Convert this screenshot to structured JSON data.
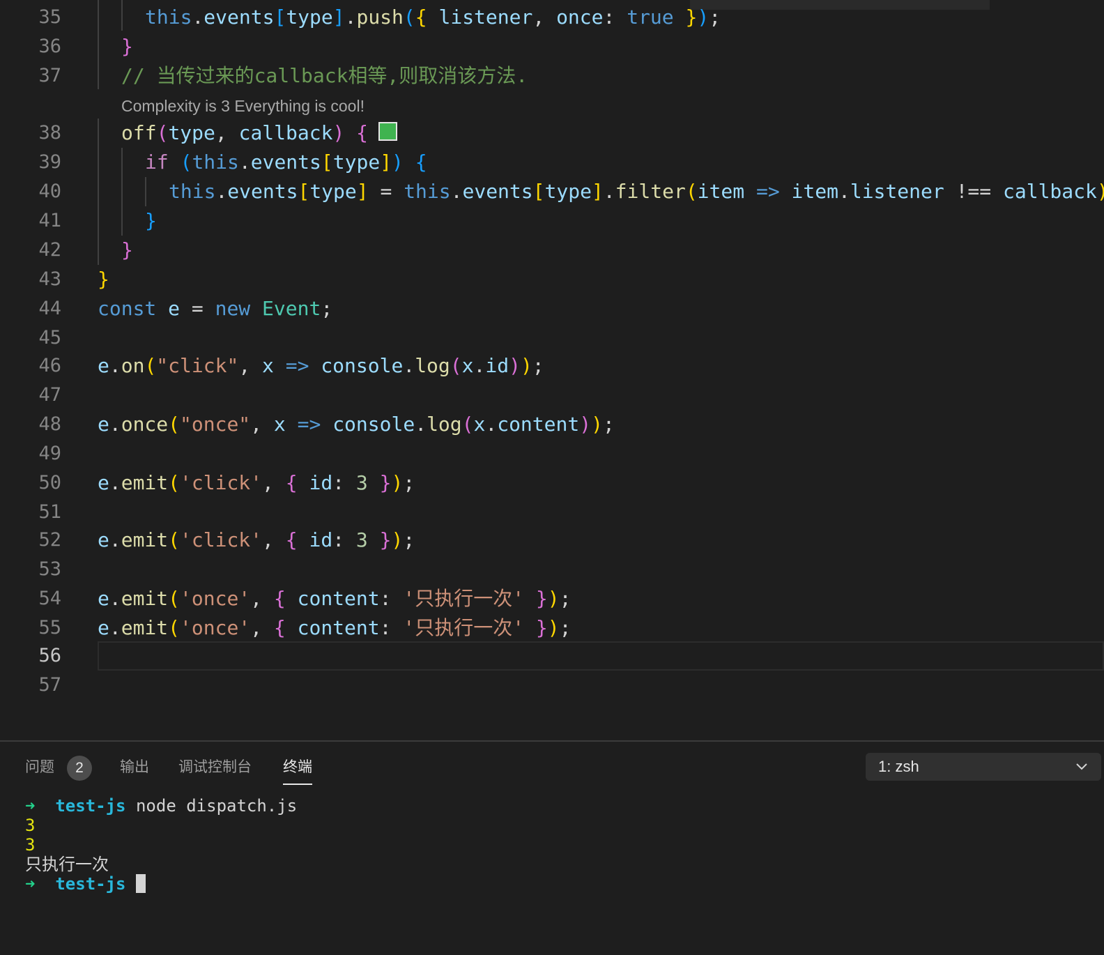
{
  "editor": {
    "codelens": "Complexity is 3 Everything is cool!",
    "active_line": 56,
    "lines": [
      {
        "num": 35,
        "code": [
          [
            "this",
            "k"
          ],
          [
            ".",
            "p"
          ],
          [
            "events",
            "v"
          ],
          [
            "[",
            "b3"
          ],
          [
            "type",
            "v"
          ],
          [
            "]",
            "b3"
          ],
          [
            ".",
            "p"
          ],
          [
            "push",
            "f"
          ],
          [
            "(",
            "b3"
          ],
          [
            "{ ",
            "b1"
          ],
          [
            "listener",
            "v"
          ],
          [
            ", ",
            "p"
          ],
          [
            "once",
            "v"
          ],
          [
            ": ",
            "p"
          ],
          [
            "true",
            "k"
          ],
          [
            " }",
            "b1"
          ],
          [
            ")",
            "b3"
          ],
          [
            ";",
            "p"
          ]
        ]
      },
      {
        "num": 36,
        "code": [
          [
            "}",
            "b2"
          ]
        ]
      },
      {
        "num": 37,
        "code": [
          [
            "// 当传过来的callback相等,则取消该方法.",
            "c"
          ]
        ]
      },
      {
        "num": 38,
        "code": [
          [
            "off",
            "f"
          ],
          [
            "(",
            "b2"
          ],
          [
            "type",
            "v"
          ],
          [
            ", ",
            "p"
          ],
          [
            "callback",
            "v"
          ],
          [
            ")",
            "b2"
          ],
          [
            " ",
            "p"
          ],
          [
            "{",
            "b2"
          ]
        ]
      },
      {
        "num": 39,
        "code": [
          [
            "if",
            "kc"
          ],
          [
            " ",
            "p"
          ],
          [
            "(",
            "b3"
          ],
          [
            "this",
            "k"
          ],
          [
            ".",
            "p"
          ],
          [
            "events",
            "v"
          ],
          [
            "[",
            "b1"
          ],
          [
            "type",
            "v"
          ],
          [
            "]",
            "b1"
          ],
          [
            ")",
            "b3"
          ],
          [
            " ",
            "p"
          ],
          [
            "{",
            "b3"
          ]
        ]
      },
      {
        "num": 40,
        "code": [
          [
            "this",
            "k"
          ],
          [
            ".",
            "p"
          ],
          [
            "events",
            "v"
          ],
          [
            "[",
            "b1"
          ],
          [
            "type",
            "v"
          ],
          [
            "]",
            "b1"
          ],
          [
            " = ",
            "p"
          ],
          [
            "this",
            "k"
          ],
          [
            ".",
            "p"
          ],
          [
            "events",
            "v"
          ],
          [
            "[",
            "b1"
          ],
          [
            "type",
            "v"
          ],
          [
            "]",
            "b1"
          ],
          [
            ".",
            "p"
          ],
          [
            "filter",
            "f"
          ],
          [
            "(",
            "b1"
          ],
          [
            "item",
            "v"
          ],
          [
            " => ",
            "k"
          ],
          [
            "item",
            "v"
          ],
          [
            ".",
            "p"
          ],
          [
            "listener",
            "v"
          ],
          [
            " !== ",
            "p"
          ],
          [
            "callback",
            "v"
          ],
          [
            ")",
            "b1"
          ]
        ]
      },
      {
        "num": 41,
        "code": [
          [
            "}",
            "b3"
          ]
        ]
      },
      {
        "num": 42,
        "code": [
          [
            "}",
            "b2"
          ]
        ]
      },
      {
        "num": 43,
        "code": [
          [
            "}",
            "b1"
          ]
        ]
      },
      {
        "num": 44,
        "code": [
          [
            "const",
            "k"
          ],
          [
            " ",
            "p"
          ],
          [
            "e",
            "v"
          ],
          [
            " = ",
            "p"
          ],
          [
            "new",
            "k"
          ],
          [
            " ",
            "p"
          ],
          [
            "Event",
            "t"
          ],
          [
            ";",
            "p"
          ]
        ]
      },
      {
        "num": 45,
        "code": []
      },
      {
        "num": 46,
        "code": [
          [
            "e",
            "v"
          ],
          [
            ".",
            "p"
          ],
          [
            "on",
            "f"
          ],
          [
            "(",
            "b1"
          ],
          [
            "\"click\"",
            "s"
          ],
          [
            ", ",
            "p"
          ],
          [
            "x",
            "v"
          ],
          [
            " => ",
            "k"
          ],
          [
            "console",
            "v"
          ],
          [
            ".",
            "p"
          ],
          [
            "log",
            "f"
          ],
          [
            "(",
            "b2"
          ],
          [
            "x",
            "v"
          ],
          [
            ".",
            "p"
          ],
          [
            "id",
            "v"
          ],
          [
            ")",
            "b2"
          ],
          [
            ")",
            "b1"
          ],
          [
            ";",
            "p"
          ]
        ]
      },
      {
        "num": 47,
        "code": []
      },
      {
        "num": 48,
        "code": [
          [
            "e",
            "v"
          ],
          [
            ".",
            "p"
          ],
          [
            "once",
            "f"
          ],
          [
            "(",
            "b1"
          ],
          [
            "\"once\"",
            "s"
          ],
          [
            ", ",
            "p"
          ],
          [
            "x",
            "v"
          ],
          [
            " => ",
            "k"
          ],
          [
            "console",
            "v"
          ],
          [
            ".",
            "p"
          ],
          [
            "log",
            "f"
          ],
          [
            "(",
            "b2"
          ],
          [
            "x",
            "v"
          ],
          [
            ".",
            "p"
          ],
          [
            "content",
            "v"
          ],
          [
            ")",
            "b2"
          ],
          [
            ")",
            "b1"
          ],
          [
            ";",
            "p"
          ]
        ]
      },
      {
        "num": 49,
        "code": []
      },
      {
        "num": 50,
        "code": [
          [
            "e",
            "v"
          ],
          [
            ".",
            "p"
          ],
          [
            "emit",
            "f"
          ],
          [
            "(",
            "b1"
          ],
          [
            "'click'",
            "s"
          ],
          [
            ", ",
            "p"
          ],
          [
            "{ ",
            "b2"
          ],
          [
            "id",
            "v"
          ],
          [
            ": ",
            "p"
          ],
          [
            "3",
            "n"
          ],
          [
            " }",
            "b2"
          ],
          [
            ")",
            "b1"
          ],
          [
            ";",
            "p"
          ]
        ]
      },
      {
        "num": 51,
        "code": []
      },
      {
        "num": 52,
        "code": [
          [
            "e",
            "v"
          ],
          [
            ".",
            "p"
          ],
          [
            "emit",
            "f"
          ],
          [
            "(",
            "b1"
          ],
          [
            "'click'",
            "s"
          ],
          [
            ", ",
            "p"
          ],
          [
            "{ ",
            "b2"
          ],
          [
            "id",
            "v"
          ],
          [
            ": ",
            "p"
          ],
          [
            "3",
            "n"
          ],
          [
            " }",
            "b2"
          ],
          [
            ")",
            "b1"
          ],
          [
            ";",
            "p"
          ]
        ]
      },
      {
        "num": 53,
        "code": []
      },
      {
        "num": 54,
        "code": [
          [
            "e",
            "v"
          ],
          [
            ".",
            "p"
          ],
          [
            "emit",
            "f"
          ],
          [
            "(",
            "b1"
          ],
          [
            "'once'",
            "s"
          ],
          [
            ", ",
            "p"
          ],
          [
            "{ ",
            "b2"
          ],
          [
            "content",
            "v"
          ],
          [
            ": ",
            "p"
          ],
          [
            "'只执行一次'",
            "s"
          ],
          [
            " }",
            "b2"
          ],
          [
            ")",
            "b1"
          ],
          [
            ";",
            "p"
          ]
        ]
      },
      {
        "num": 55,
        "code": [
          [
            "e",
            "v"
          ],
          [
            ".",
            "p"
          ],
          [
            "emit",
            "f"
          ],
          [
            "(",
            "b1"
          ],
          [
            "'once'",
            "s"
          ],
          [
            ", ",
            "p"
          ],
          [
            "{ ",
            "b2"
          ],
          [
            "content",
            "v"
          ],
          [
            ": ",
            "p"
          ],
          [
            "'只执行一次'",
            "s"
          ],
          [
            " }",
            "b2"
          ],
          [
            ")",
            "b1"
          ],
          [
            ";",
            "p"
          ]
        ]
      },
      {
        "num": 56,
        "code": []
      },
      {
        "num": 57,
        "code": []
      }
    ]
  },
  "panel": {
    "tabs": [
      {
        "label": "问题",
        "badge": "2"
      },
      {
        "label": "输出"
      },
      {
        "label": "调试控制台"
      },
      {
        "label": "终端",
        "active": true
      }
    ],
    "terminal_select": "1: zsh",
    "terminal": {
      "prompt_arrow": "➜",
      "dir": "test-js",
      "command": "node dispatch.js",
      "output": [
        "3",
        "3",
        "只执行一次"
      ]
    }
  },
  "colors": {
    "background": "#1e1e1e",
    "comment": "#6a9955",
    "keyword": "#569cd6",
    "string": "#ce9178",
    "swatch": "#3fb350"
  }
}
